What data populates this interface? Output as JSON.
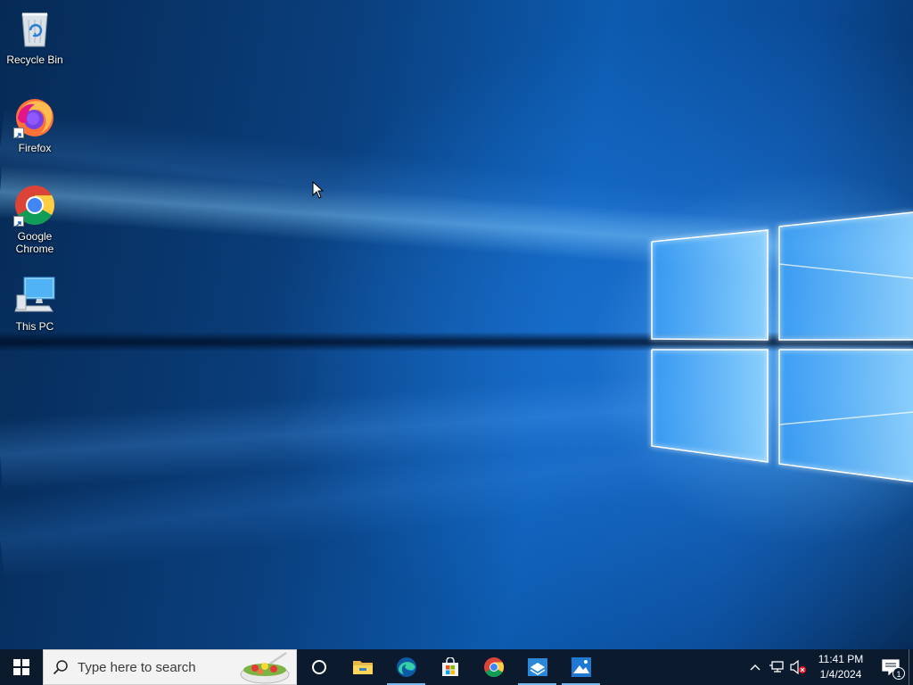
{
  "desktop": {
    "icons": [
      {
        "label": "Recycle Bin",
        "icon": "recycle-bin-icon"
      },
      {
        "label": "Firefox",
        "icon": "firefox-icon"
      },
      {
        "label": "Google Chrome",
        "icon": "chrome-icon"
      },
      {
        "label": "This PC",
        "icon": "this-pc-icon"
      }
    ]
  },
  "taskbar": {
    "search": {
      "placeholder": "Type here to search"
    },
    "pinned": [
      {
        "name": "Task View",
        "icon": "cortana-circle-icon"
      },
      {
        "name": "File Explorer",
        "icon": "folder-icon"
      },
      {
        "name": "Microsoft Edge",
        "icon": "edge-icon"
      },
      {
        "name": "Microsoft Store",
        "icon": "store-bag-icon"
      },
      {
        "name": "Google Chrome",
        "icon": "chrome-icon"
      },
      {
        "name": "App",
        "icon": "blue-app-icon"
      },
      {
        "name": "Photos",
        "icon": "photos-icon"
      }
    ],
    "tray": {
      "time": "11:41 PM",
      "date": "1/4/2024",
      "notification_count": "1"
    }
  },
  "colors": {
    "taskbar": "#0c1a2e",
    "active_indicator": "#76b9ed",
    "accent": "#0078d7"
  }
}
